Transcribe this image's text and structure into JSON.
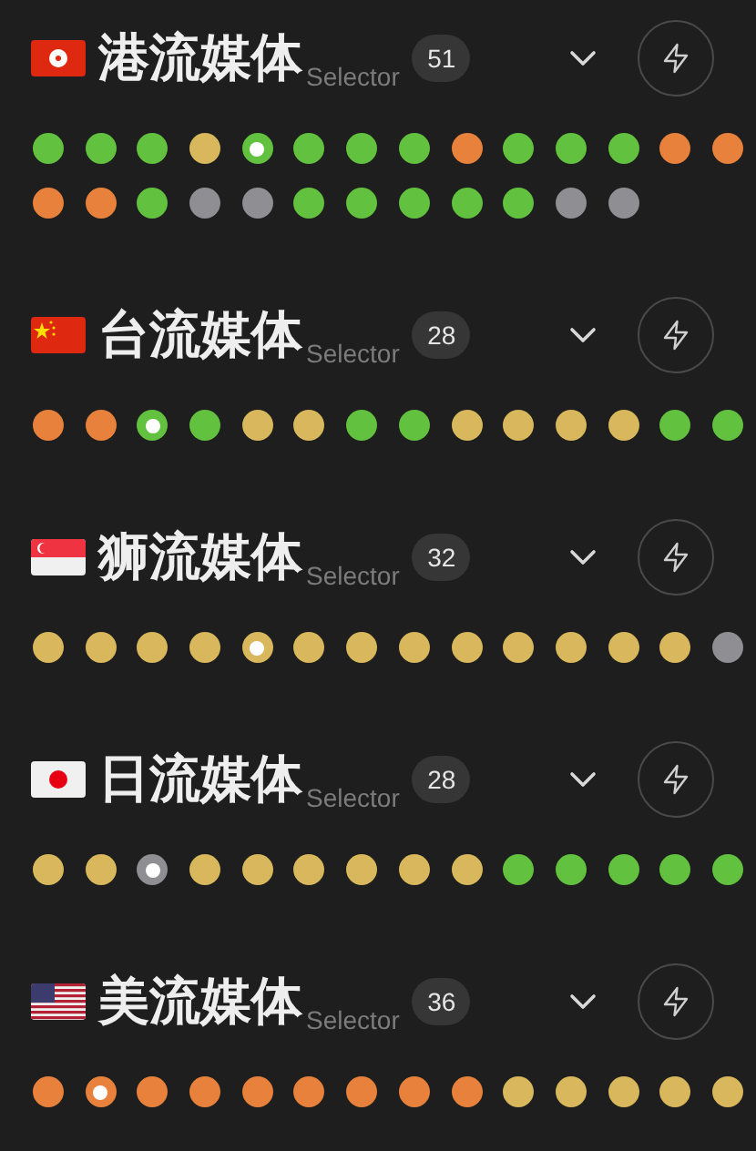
{
  "groups": [
    {
      "kind": "hk",
      "title": "港流媒体",
      "subtitle": "Selector",
      "count": "51",
      "nodes": [
        {
          "color": "#62c13f",
          "selected": false
        },
        {
          "color": "#62c13f",
          "selected": false
        },
        {
          "color": "#62c13f",
          "selected": false
        },
        {
          "color": "#d8b75d",
          "selected": false
        },
        {
          "color": "#62c13f",
          "selected": true
        },
        {
          "color": "#62c13f",
          "selected": false
        },
        {
          "color": "#62c13f",
          "selected": false
        },
        {
          "color": "#62c13f",
          "selected": false
        },
        {
          "color": "#e8813c",
          "selected": false
        },
        {
          "color": "#62c13f",
          "selected": false
        },
        {
          "color": "#62c13f",
          "selected": false
        },
        {
          "color": "#62c13f",
          "selected": false
        },
        {
          "color": "#e8813c",
          "selected": false
        },
        {
          "color": "#e8813c",
          "selected": false
        },
        {
          "color": "#e8813c",
          "selected": false
        },
        {
          "color": "#e8813c",
          "selected": false
        },
        {
          "color": "#62c13f",
          "selected": false
        },
        {
          "color": "#8e8e93",
          "selected": false
        },
        {
          "color": "#8e8e93",
          "selected": false
        },
        {
          "color": "#62c13f",
          "selected": false
        },
        {
          "color": "#62c13f",
          "selected": false
        },
        {
          "color": "#62c13f",
          "selected": false
        },
        {
          "color": "#62c13f",
          "selected": false
        },
        {
          "color": "#62c13f",
          "selected": false
        },
        {
          "color": "#8e8e93",
          "selected": false
        },
        {
          "color": "#8e8e93",
          "selected": false
        }
      ]
    },
    {
      "kind": "cn",
      "title": "台流媒体",
      "subtitle": "Selector",
      "count": "28",
      "nodes": [
        {
          "color": "#e8813c",
          "selected": false
        },
        {
          "color": "#e8813c",
          "selected": false
        },
        {
          "color": "#62c13f",
          "selected": true
        },
        {
          "color": "#62c13f",
          "selected": false
        },
        {
          "color": "#d8b75d",
          "selected": false
        },
        {
          "color": "#d8b75d",
          "selected": false
        },
        {
          "color": "#62c13f",
          "selected": false
        },
        {
          "color": "#62c13f",
          "selected": false
        },
        {
          "color": "#d8b75d",
          "selected": false
        },
        {
          "color": "#d8b75d",
          "selected": false
        },
        {
          "color": "#d8b75d",
          "selected": false
        },
        {
          "color": "#d8b75d",
          "selected": false
        },
        {
          "color": "#62c13f",
          "selected": false
        },
        {
          "color": "#62c13f",
          "selected": false
        }
      ]
    },
    {
      "kind": "sg",
      "title": "狮流媒体",
      "subtitle": "Selector",
      "count": "32",
      "nodes": [
        {
          "color": "#d8b75d",
          "selected": false
        },
        {
          "color": "#d8b75d",
          "selected": false
        },
        {
          "color": "#d8b75d",
          "selected": false
        },
        {
          "color": "#d8b75d",
          "selected": false
        },
        {
          "color": "#d8b75d",
          "selected": true
        },
        {
          "color": "#d8b75d",
          "selected": false
        },
        {
          "color": "#d8b75d",
          "selected": false
        },
        {
          "color": "#d8b75d",
          "selected": false
        },
        {
          "color": "#d8b75d",
          "selected": false
        },
        {
          "color": "#d8b75d",
          "selected": false
        },
        {
          "color": "#d8b75d",
          "selected": false
        },
        {
          "color": "#d8b75d",
          "selected": false
        },
        {
          "color": "#d8b75d",
          "selected": false
        },
        {
          "color": "#8e8e93",
          "selected": false
        }
      ]
    },
    {
      "kind": "jp",
      "title": "日流媒体",
      "subtitle": "Selector",
      "count": "28",
      "nodes": [
        {
          "color": "#d8b75d",
          "selected": false
        },
        {
          "color": "#d8b75d",
          "selected": false
        },
        {
          "color": "#8e8e93",
          "selected": true
        },
        {
          "color": "#d8b75d",
          "selected": false
        },
        {
          "color": "#d8b75d",
          "selected": false
        },
        {
          "color": "#d8b75d",
          "selected": false
        },
        {
          "color": "#d8b75d",
          "selected": false
        },
        {
          "color": "#d8b75d",
          "selected": false
        },
        {
          "color": "#d8b75d",
          "selected": false
        },
        {
          "color": "#62c13f",
          "selected": false
        },
        {
          "color": "#62c13f",
          "selected": false
        },
        {
          "color": "#62c13f",
          "selected": false
        },
        {
          "color": "#62c13f",
          "selected": false
        },
        {
          "color": "#62c13f",
          "selected": false
        }
      ]
    },
    {
      "kind": "us",
      "title": "美流媒体",
      "subtitle": "Selector",
      "count": "36",
      "nodes": [
        {
          "color": "#e8813c",
          "selected": false
        },
        {
          "color": "#e8813c",
          "selected": true
        },
        {
          "color": "#e8813c",
          "selected": false
        },
        {
          "color": "#e8813c",
          "selected": false
        },
        {
          "color": "#e8813c",
          "selected": false
        },
        {
          "color": "#e8813c",
          "selected": false
        },
        {
          "color": "#e8813c",
          "selected": false
        },
        {
          "color": "#e8813c",
          "selected": false
        },
        {
          "color": "#e8813c",
          "selected": false
        },
        {
          "color": "#d8b75d",
          "selected": false
        },
        {
          "color": "#d8b75d",
          "selected": false
        },
        {
          "color": "#d8b75d",
          "selected": false
        },
        {
          "color": "#d8b75d",
          "selected": false
        },
        {
          "color": "#d8b75d",
          "selected": false
        }
      ]
    }
  ]
}
